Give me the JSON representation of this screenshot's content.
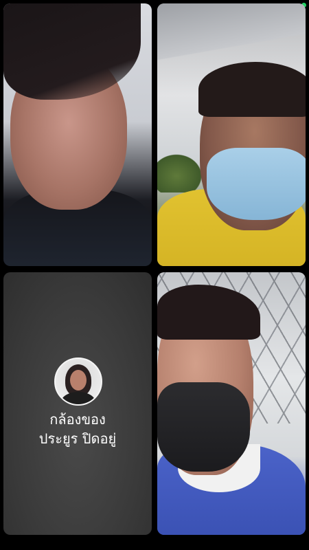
{
  "participants": [
    {
      "video": "on"
    },
    {
      "video": "on"
    },
    {
      "video": "off",
      "camera_off_line1": "กล้องของ",
      "camera_off_line2": "ประยูร ปิดอยู่"
    },
    {
      "video": "on"
    }
  ],
  "status": {
    "indicator_color": "#25d366"
  }
}
